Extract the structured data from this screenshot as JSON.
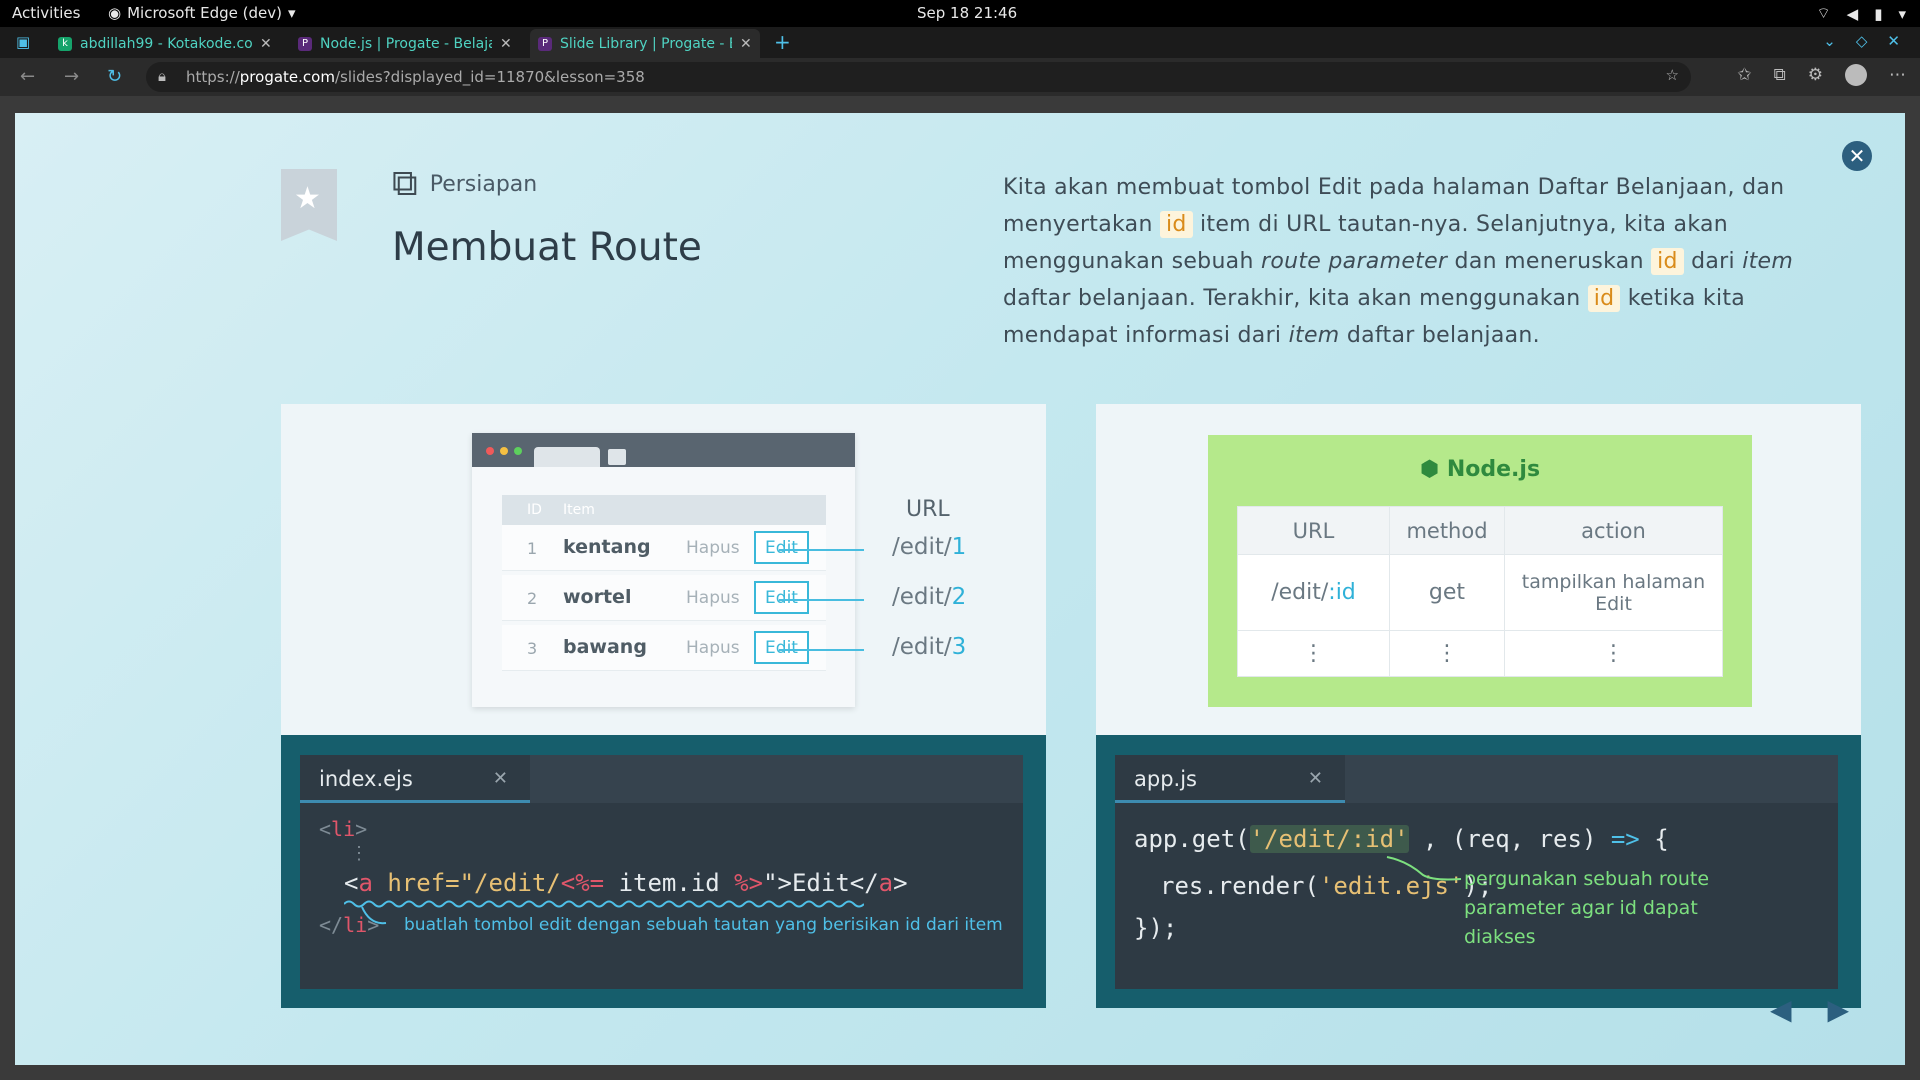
{
  "system": {
    "activities": "Activities",
    "app": "Microsoft Edge (dev)",
    "clock": "Sep 18  21:46"
  },
  "tabs": [
    {
      "title": "abdillah99 - Kotakode.co",
      "color": "#16a36b"
    },
    {
      "title": "Node.js | Progate - Belaja",
      "color": "#5a2a7a"
    },
    {
      "title": "Slide Library | Progate - B",
      "color": "#5a2a7a"
    }
  ],
  "address": {
    "prefix": "https://",
    "host": "progate.com",
    "path": "/slides?displayed_id=11870&lesson=358"
  },
  "slide": {
    "category": "Persiapan",
    "title": "Membuat Route",
    "desc": {
      "p1": "Kita akan membuat tombol Edit pada halaman Daftar Belanjaan, dan menyertakan ",
      "code": "id",
      "p2": " item di URL tautan-nya. Selanjutnya, kita akan menggunakan sebuah ",
      "em1": "route parameter",
      "p3": " dan meneruskan ",
      "p4": " dari ",
      "em2": "item",
      "p5": " daftar belanjaan. Terakhir, kita akan menggunakan ",
      "p6": " ketika kita mendapat informasi dari ",
      "em3": "item",
      "p7": " daftar belanjaan."
    },
    "mock": {
      "head_id": "ID",
      "head_item": "Item",
      "url_label": "URL",
      "rows": [
        {
          "n": "1",
          "item": "kentang",
          "hapus": "Hapus",
          "edit": "Edit",
          "url_prefix": "/edit/",
          "url_id": "1"
        },
        {
          "n": "2",
          "item": "wortel",
          "hapus": "Hapus",
          "edit": "Edit",
          "url_prefix": "/edit/",
          "url_id": "2"
        },
        {
          "n": "3",
          "item": "bawang",
          "hapus": "Hapus",
          "edit": "Edit",
          "url_prefix": "/edit/",
          "url_id": "3"
        }
      ]
    },
    "node": {
      "title": "Node.js",
      "cols": [
        "URL",
        "method",
        "action"
      ],
      "row": {
        "url_prefix": "/edit/",
        "url_param": ":id",
        "method": "get",
        "action": "tampilkan halaman Edit"
      },
      "more": "⋮"
    },
    "editor1": {
      "filename": "index.ejs",
      "l1a": "<",
      "l1b": "li",
      "l1c": ">",
      "vdots": "⋮",
      "l3a": "<",
      "l3b": "a",
      "l3c": " href=",
      "l3d": "\"/edit/",
      "l3e": "<%=",
      "l3f": " item.id ",
      "l3g": "%>",
      "l3h": "\">Edit</",
      "l3i": "a",
      "l3j": ">",
      "l4a": "</",
      "l4b": "li",
      "l4c": ">",
      "annotation": "buatlah tombol edit dengan sebuah tautan yang berisikan id dari item"
    },
    "editor2": {
      "filename": "app.js",
      "l1a": "app.get(",
      "l1b": "'/edit/:id'",
      "l1c": " , (req, res) ",
      "l1d": "=>",
      "l1e": " {",
      "l2a": "res.render(",
      "l2b": "'edit.ejs'",
      "l2c": ");",
      "l3": "});",
      "annotation": "pergunakan sebuah route parameter agar id dapat diakses"
    },
    "nav": {
      "prev": "◀",
      "next": "▶"
    }
  }
}
